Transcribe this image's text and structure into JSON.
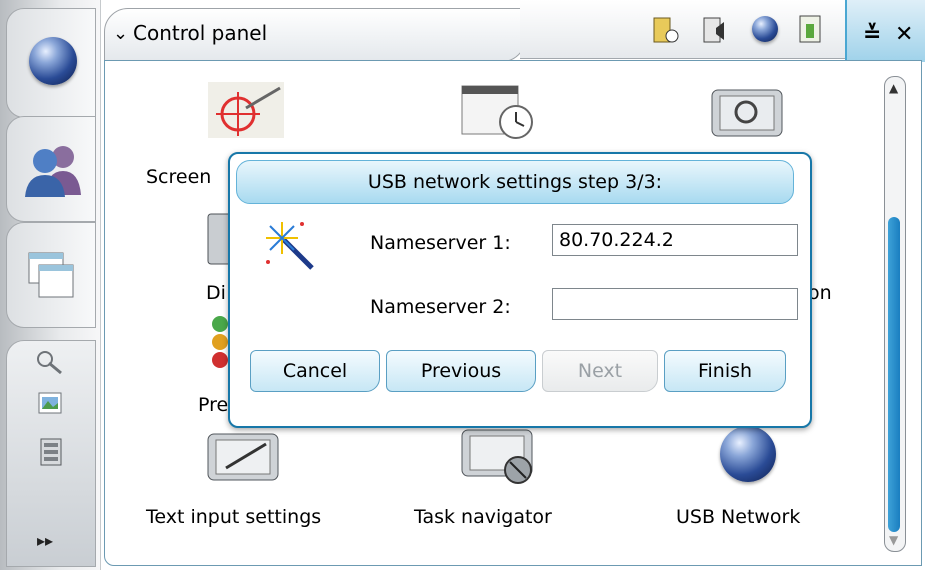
{
  "titlebar": {
    "title": "Control panel"
  },
  "applets": [
    {
      "label": "Screen"
    },
    {
      "label": "Di"
    },
    {
      "label": "on"
    },
    {
      "label": "Pre"
    },
    {
      "label": "Text input settings"
    },
    {
      "label": "Task navigator"
    },
    {
      "label": "USB Network"
    }
  ],
  "dialog": {
    "title": "USB network settings step 3/3:",
    "fields": [
      {
        "label": "Nameserver 1:",
        "value": "80.70.224.2"
      },
      {
        "label": "Nameserver 2:",
        "value": ""
      }
    ],
    "buttons": {
      "cancel": "Cancel",
      "previous": "Previous",
      "next": "Next",
      "finish": "Finish"
    }
  },
  "nav": {
    "more_glyph": "▸▸"
  },
  "windowControls": {
    "minimize_glyph": "≚",
    "close_glyph": "✕"
  },
  "colors": {
    "accent": "#1777a8",
    "scroll": "#2a8cca"
  }
}
